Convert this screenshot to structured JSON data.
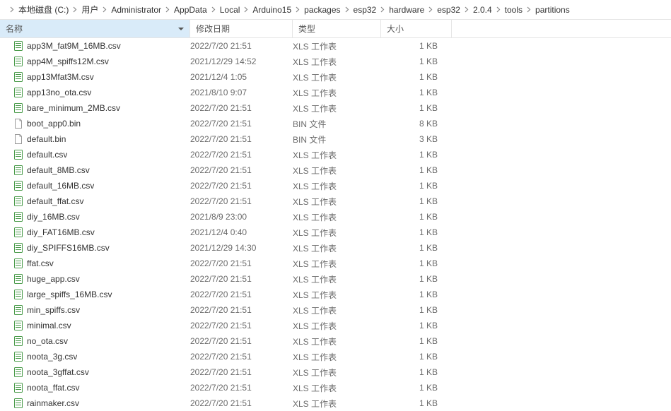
{
  "breadcrumb": [
    "本地磁盘 (C:)",
    "用户",
    "Administrator",
    "AppData",
    "Local",
    "Arduino15",
    "packages",
    "esp32",
    "hardware",
    "esp32",
    "2.0.4",
    "tools",
    "partitions"
  ],
  "columns": {
    "name": "名称",
    "date": "修改日期",
    "type": "类型",
    "size": "大小"
  },
  "type_labels": {
    "xls": "XLS 工作表",
    "bin": "BIN 文件"
  },
  "files": [
    {
      "name": "app3M_fat9M_16MB.csv",
      "date": "2022/7/20 21:51",
      "typekey": "xls",
      "size": "1 KB",
      "icon": "csv"
    },
    {
      "name": "app4M_spiffs12M.csv",
      "date": "2021/12/29 14:52",
      "typekey": "xls",
      "size": "1 KB",
      "icon": "csv"
    },
    {
      "name": "app13Mfat3M.csv",
      "date": "2021/12/4 1:05",
      "typekey": "xls",
      "size": "1 KB",
      "icon": "csv"
    },
    {
      "name": "app13no_ota.csv",
      "date": "2021/8/10 9:07",
      "typekey": "xls",
      "size": "1 KB",
      "icon": "csv"
    },
    {
      "name": "bare_minimum_2MB.csv",
      "date": "2022/7/20 21:51",
      "typekey": "xls",
      "size": "1 KB",
      "icon": "csv"
    },
    {
      "name": "boot_app0.bin",
      "date": "2022/7/20 21:51",
      "typekey": "bin",
      "size": "8 KB",
      "icon": "bin"
    },
    {
      "name": "default.bin",
      "date": "2022/7/20 21:51",
      "typekey": "bin",
      "size": "3 KB",
      "icon": "bin"
    },
    {
      "name": "default.csv",
      "date": "2022/7/20 21:51",
      "typekey": "xls",
      "size": "1 KB",
      "icon": "csv"
    },
    {
      "name": "default_8MB.csv",
      "date": "2022/7/20 21:51",
      "typekey": "xls",
      "size": "1 KB",
      "icon": "csv"
    },
    {
      "name": "default_16MB.csv",
      "date": "2022/7/20 21:51",
      "typekey": "xls",
      "size": "1 KB",
      "icon": "csv"
    },
    {
      "name": "default_ffat.csv",
      "date": "2022/7/20 21:51",
      "typekey": "xls",
      "size": "1 KB",
      "icon": "csv"
    },
    {
      "name": "diy_16MB.csv",
      "date": "2021/8/9 23:00",
      "typekey": "xls",
      "size": "1 KB",
      "icon": "csv"
    },
    {
      "name": "diy_FAT16MB.csv",
      "date": "2021/12/4 0:40",
      "typekey": "xls",
      "size": "1 KB",
      "icon": "csv"
    },
    {
      "name": "diy_SPIFFS16MB.csv",
      "date": "2021/12/29 14:30",
      "typekey": "xls",
      "size": "1 KB",
      "icon": "csv"
    },
    {
      "name": "ffat.csv",
      "date": "2022/7/20 21:51",
      "typekey": "xls",
      "size": "1 KB",
      "icon": "csv"
    },
    {
      "name": "huge_app.csv",
      "date": "2022/7/20 21:51",
      "typekey": "xls",
      "size": "1 KB",
      "icon": "csv"
    },
    {
      "name": "large_spiffs_16MB.csv",
      "date": "2022/7/20 21:51",
      "typekey": "xls",
      "size": "1 KB",
      "icon": "csv"
    },
    {
      "name": "min_spiffs.csv",
      "date": "2022/7/20 21:51",
      "typekey": "xls",
      "size": "1 KB",
      "icon": "csv"
    },
    {
      "name": "minimal.csv",
      "date": "2022/7/20 21:51",
      "typekey": "xls",
      "size": "1 KB",
      "icon": "csv"
    },
    {
      "name": "no_ota.csv",
      "date": "2022/7/20 21:51",
      "typekey": "xls",
      "size": "1 KB",
      "icon": "csv"
    },
    {
      "name": "noota_3g.csv",
      "date": "2022/7/20 21:51",
      "typekey": "xls",
      "size": "1 KB",
      "icon": "csv"
    },
    {
      "name": "noota_3gffat.csv",
      "date": "2022/7/20 21:51",
      "typekey": "xls",
      "size": "1 KB",
      "icon": "csv"
    },
    {
      "name": "noota_ffat.csv",
      "date": "2022/7/20 21:51",
      "typekey": "xls",
      "size": "1 KB",
      "icon": "csv"
    },
    {
      "name": "rainmaker.csv",
      "date": "2022/7/20 21:51",
      "typekey": "xls",
      "size": "1 KB",
      "icon": "csv"
    }
  ]
}
